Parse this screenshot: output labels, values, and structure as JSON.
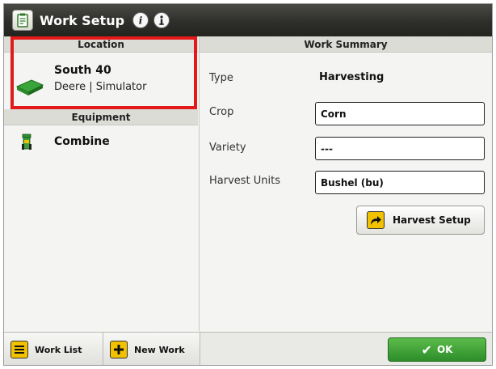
{
  "titlebar": {
    "title": "Work Setup",
    "icons": [
      "work-setup-icon",
      "info-icon",
      "help-icon"
    ]
  },
  "left_panel": {
    "location_header": "Location",
    "location": {
      "name": "South 40",
      "subtitle": "Deere | Simulator",
      "icon": "field-icon"
    },
    "equipment_header": "Equipment",
    "equipment": {
      "name": "Combine",
      "icon": "combine-icon"
    }
  },
  "work_summary": {
    "header": "Work Summary",
    "type_label": "Type",
    "type_value": "Harvesting",
    "crop_label": "Crop",
    "crop_value": "Corn",
    "variety_label": "Variety",
    "variety_value": "---",
    "units_label": "Harvest Units",
    "units_value": "Bushel (bu)",
    "harvest_setup_label": "Harvest Setup"
  },
  "bottombar": {
    "work_list_label": "Work List",
    "new_work_label": "New Work",
    "ok_label": "OK"
  },
  "colors": {
    "accent_green": "#2d8d2a",
    "highlight_red": "#e21a1a",
    "button_yellow": "#f2c200"
  }
}
